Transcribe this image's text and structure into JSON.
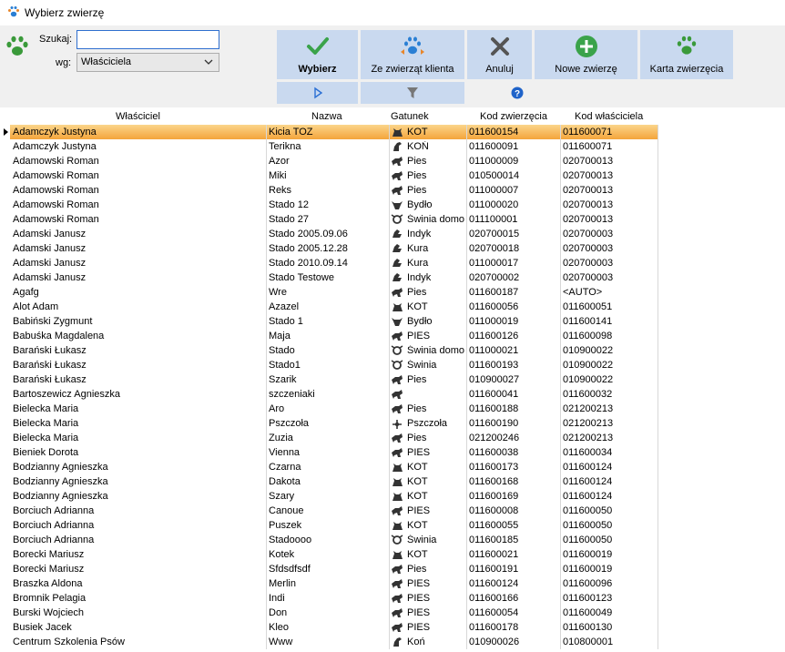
{
  "window": {
    "title": "Wybierz zwierzę"
  },
  "search": {
    "label": "Szukaj:",
    "value": "",
    "placeholder": ""
  },
  "by": {
    "label": "wg:",
    "selected": "Właściciela"
  },
  "buttons": {
    "select": "Wybierz",
    "from_client": "Ze zwierząt klienta",
    "cancel": "Anuluj",
    "new_animal": "Nowe zwierzę",
    "card": "Karta zwierzęcia"
  },
  "columns": [
    "Właściciel",
    "Nazwa",
    "Gatunek",
    "Kod zwierzęcia",
    "Kod właściciela"
  ],
  "rows": [
    [
      "Adamczyk  Justyna",
      "Kicia TOZ",
      "KOT",
      "011600154",
      "011600071",
      "cat"
    ],
    [
      "Adamczyk  Justyna",
      "Terikna",
      "KOŃ",
      "011600091",
      "011600071",
      "horse"
    ],
    [
      "Adamowski Roman",
      "Azor",
      "Pies",
      "011000009",
      "020700013",
      "dog"
    ],
    [
      "Adamowski Roman",
      "Miki",
      "Pies",
      "010500014",
      "020700013",
      "dog"
    ],
    [
      "Adamowski Roman",
      "Reks",
      "Pies",
      "011000007",
      "020700013",
      "dog"
    ],
    [
      "Adamowski Roman",
      "Stado 12",
      "Bydło",
      "011000020",
      "020700013",
      "cow"
    ],
    [
      "Adamowski Roman",
      "Stado 27",
      "Świnia domo",
      "011100001",
      "020700013",
      "pig"
    ],
    [
      "Adamski Janusz",
      "Stado 2005.09.06",
      "Indyk",
      "020700015",
      "020700003",
      "bird"
    ],
    [
      "Adamski Janusz",
      "Stado 2005.12.28",
      "Kura",
      "020700018",
      "020700003",
      "bird"
    ],
    [
      "Adamski Janusz",
      "Stado 2010.09.14",
      "Kura",
      "011000017",
      "020700003",
      "bird"
    ],
    [
      "Adamski Janusz",
      "Stado Testowe",
      "Indyk",
      "020700002",
      "020700003",
      "bird"
    ],
    [
      "Agafg",
      "Wre",
      "Pies",
      "011600187",
      "<AUTO>",
      "dog"
    ],
    [
      "Alot  Adam",
      "Azazel",
      "KOT",
      "011600056",
      "011600051",
      "cat"
    ],
    [
      "Babiński Zygmunt",
      "Stado 1",
      "Bydło",
      "011000019",
      "011600141",
      "cow"
    ],
    [
      "Babuśka  Magdalena",
      "Maja",
      "PIES",
      "011600126",
      "011600098",
      "dog"
    ],
    [
      "Barański Łukasz",
      "Stado",
      "Świnia domo",
      "011000021",
      "010900022",
      "pig"
    ],
    [
      "Barański Łukasz",
      "Stado1",
      "Świnia",
      "011600193",
      "010900022",
      "pig"
    ],
    [
      "Barański Łukasz",
      "Szarik",
      "Pies",
      "010900027",
      "010900022",
      "dog"
    ],
    [
      "Bartoszewicz  Agnieszka",
      "szczeniaki",
      "",
      "011600041",
      "011600032",
      "dog"
    ],
    [
      "Bielecka Maria",
      "Aro",
      "Pies",
      "011600188",
      "021200213",
      "dog"
    ],
    [
      "Bielecka Maria",
      "Pszczoła",
      "Pszczoła",
      "011600190",
      "021200213",
      "bee"
    ],
    [
      "Bielecka Maria",
      "Zuzia",
      "Pies",
      "021200246",
      "021200213",
      "dog"
    ],
    [
      "Bieniek  Dorota",
      "Vienna",
      "PIES",
      "011600038",
      "011600034",
      "dog"
    ],
    [
      "Bodzianny  Agnieszka",
      "Czarna",
      "KOT",
      "011600173",
      "011600124",
      "cat"
    ],
    [
      "Bodzianny  Agnieszka",
      "Dakota",
      "KOT",
      "011600168",
      "011600124",
      "cat"
    ],
    [
      "Bodzianny  Agnieszka",
      "Szary",
      "KOT",
      "011600169",
      "011600124",
      "cat"
    ],
    [
      "Borciuch  Adrianna",
      "Canoue",
      "PIES",
      "011600008",
      "011600050",
      "dog"
    ],
    [
      "Borciuch  Adrianna",
      "Puszek",
      "KOT",
      "011600055",
      "011600050",
      "cat"
    ],
    [
      "Borciuch  Adrianna",
      "Stadoooo",
      "Świnia",
      "011600185",
      "011600050",
      "pig"
    ],
    [
      "Borecki  Mariusz",
      "Kotek",
      "KOT",
      "011600021",
      "011600019",
      "cat"
    ],
    [
      "Borecki  Mariusz",
      "Sfdsdfsdf",
      "Pies",
      "011600191",
      "011600019",
      "dog"
    ],
    [
      "Braszka  Aldona",
      "Merlin",
      "PIES",
      "011600124",
      "011600096",
      "dog"
    ],
    [
      "Bromnik  Pelagia",
      "Indi",
      "PIES",
      "011600166",
      "011600123",
      "dog"
    ],
    [
      "Burski  Wojciech",
      "Don",
      "PIES",
      "011600054",
      "011600049",
      "dog"
    ],
    [
      "Busiek  Jacek",
      "Kleo",
      "PIES",
      "011600178",
      "011600130",
      "dog"
    ],
    [
      "Centrum Szkolenia Psów",
      "Www",
      "Koń",
      "010900026",
      "010800001",
      "horse"
    ]
  ]
}
